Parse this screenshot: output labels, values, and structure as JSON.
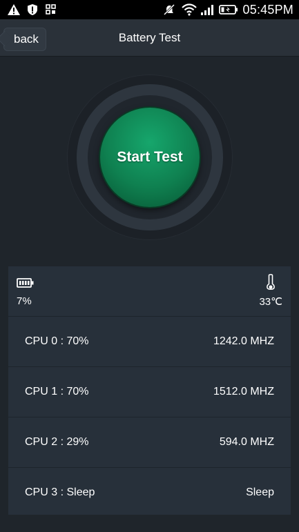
{
  "status_bar": {
    "time": "05:45PM",
    "icons": [
      "warning-icon",
      "shield-alert-icon",
      "grid-icon",
      "mute-icon",
      "wifi-icon",
      "signal-icon",
      "battery-icon"
    ]
  },
  "header": {
    "back_label": "back",
    "title": "Battery Test"
  },
  "start_button": {
    "label": "Start Test",
    "color": "#0f8050"
  },
  "summary": {
    "battery": "7%",
    "temperature": "33℃"
  },
  "cpu_rows": [
    {
      "label": "CPU  0 : 70%",
      "freq": "1242.0 MHZ"
    },
    {
      "label": "CPU  1 : 70%",
      "freq": "1512.0 MHZ"
    },
    {
      "label": "CPU  2 : 29%",
      "freq": "594.0 MHZ"
    },
    {
      "label": "CPU  3 : Sleep",
      "freq": "Sleep"
    }
  ]
}
